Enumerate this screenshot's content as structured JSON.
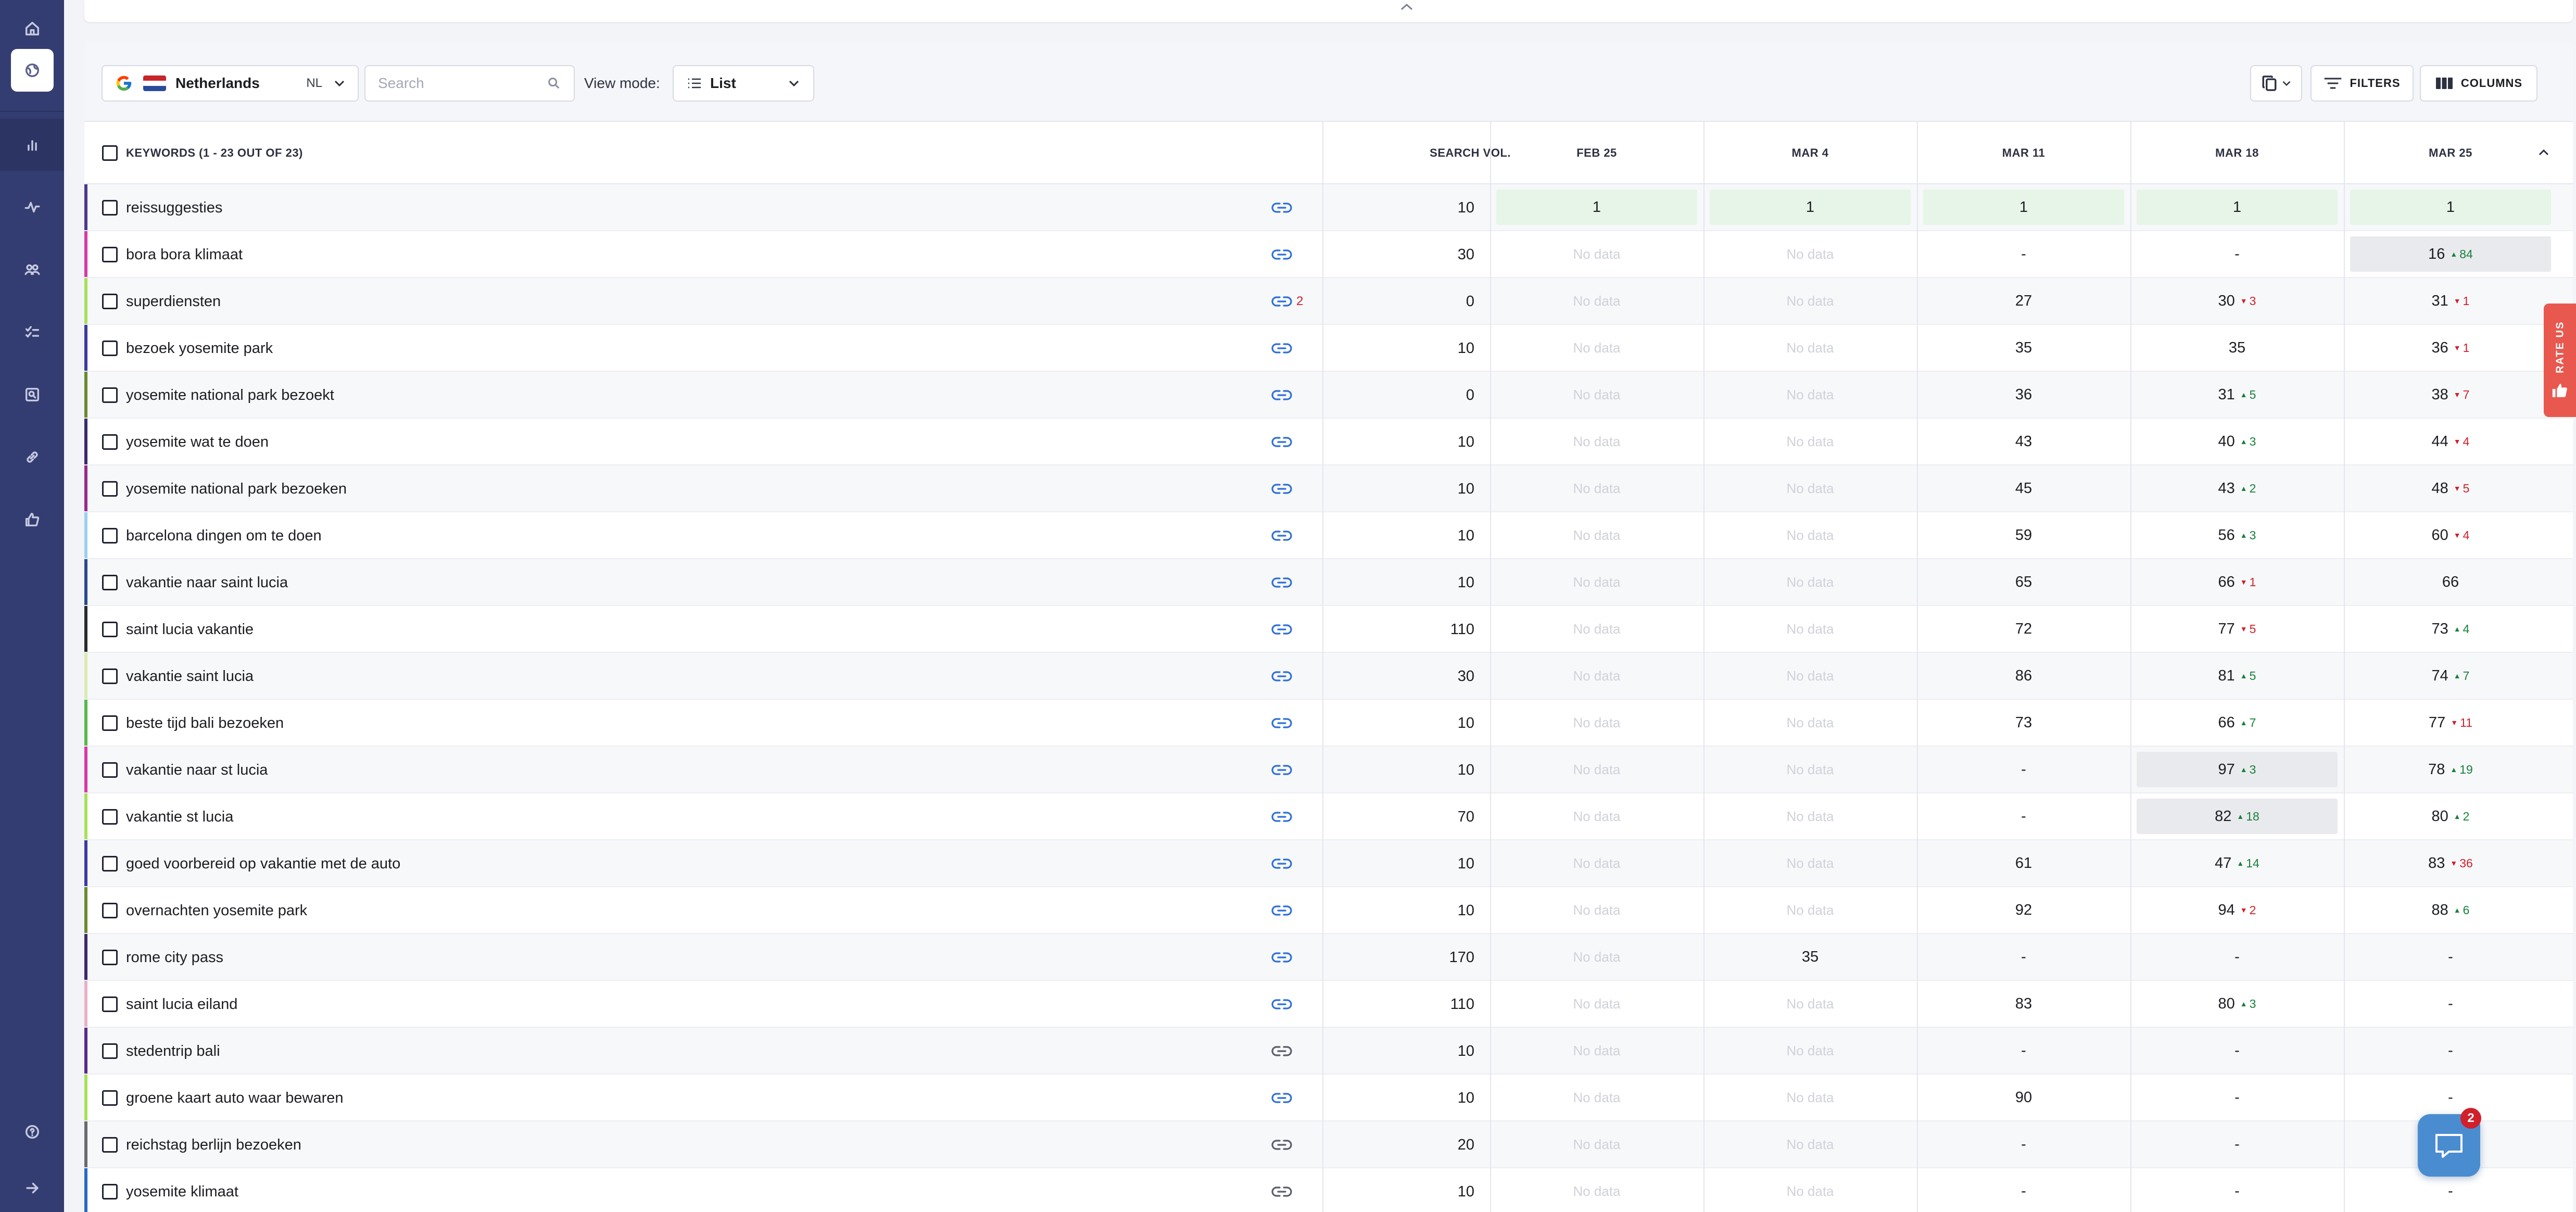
{
  "sidebar": {
    "icons": [
      "home-icon",
      "globe-icon",
      "bar-chart-icon",
      "activity-icon",
      "users-icon",
      "checklist-icon",
      "search-document-icon",
      "link-icon",
      "thumbs-up-icon",
      "help-icon",
      "expand-arrow-icon"
    ]
  },
  "toolbar": {
    "region_name": "Netherlands",
    "region_code": "NL",
    "search_placeholder": "Search",
    "view_mode_label": "View mode:",
    "view_mode_value": "List",
    "filters_label": "FILTERS",
    "columns_label": "COLUMNS"
  },
  "table": {
    "keywords_header": "KEYWORDS (1 - 23 OUT OF 23)",
    "search_vol_header": "SEARCH VOL.",
    "dates": [
      "FEB 25",
      "MAR 4",
      "MAR 11",
      "MAR 18",
      "MAR 25"
    ],
    "no_data_text": "No data",
    "rows": [
      {
        "keyword": "reissuggesties",
        "bar": "#4a3a8c",
        "link": "blue",
        "link_count": "",
        "vol": "10",
        "cells": [
          {
            "v": "1",
            "style": "green"
          },
          {
            "v": "1",
            "style": "green"
          },
          {
            "v": "1",
            "style": "green"
          },
          {
            "v": "1",
            "style": "green"
          },
          {
            "v": "1",
            "style": "green"
          }
        ]
      },
      {
        "keyword": "bora bora klimaat",
        "bar": "#d63aa4",
        "link": "blue",
        "link_count": "",
        "vol": "30",
        "cells": [
          {
            "v": "No data",
            "style": "nodata"
          },
          {
            "v": "No data",
            "style": "nodata"
          },
          {
            "v": "-"
          },
          {
            "v": "-"
          },
          {
            "v": "16",
            "style": "grey",
            "chg": "84",
            "dir": "up"
          }
        ]
      },
      {
        "keyword": "superdiensten",
        "bar": "#a8e05a",
        "link": "blue",
        "link_count": "2",
        "vol": "0",
        "cells": [
          {
            "v": "No data",
            "style": "nodata"
          },
          {
            "v": "No data",
            "style": "nodata"
          },
          {
            "v": "27"
          },
          {
            "v": "30",
            "chg": "3",
            "dir": "down"
          },
          {
            "v": "31",
            "chg": "1",
            "dir": "down"
          }
        ]
      },
      {
        "keyword": "bezoek yosemite park",
        "bar": "#3c3aa0",
        "link": "blue",
        "link_count": "",
        "vol": "10",
        "cells": [
          {
            "v": "No data",
            "style": "nodata"
          },
          {
            "v": "No data",
            "style": "nodata"
          },
          {
            "v": "35"
          },
          {
            "v": "35"
          },
          {
            "v": "36",
            "chg": "1",
            "dir": "down"
          }
        ]
      },
      {
        "keyword": "yosemite national park bezoekt",
        "bar": "#6a8a2e",
        "link": "blue",
        "link_count": "",
        "vol": "0",
        "cells": [
          {
            "v": "No data",
            "style": "nodata"
          },
          {
            "v": "No data",
            "style": "nodata"
          },
          {
            "v": "36"
          },
          {
            "v": "31",
            "chg": "5",
            "dir": "up"
          },
          {
            "v": "38",
            "chg": "7",
            "dir": "down"
          }
        ]
      },
      {
        "keyword": "yosemite wat te doen",
        "bar": "#3a2a6a",
        "link": "blue",
        "link_count": "",
        "vol": "10",
        "cells": [
          {
            "v": "No data",
            "style": "nodata"
          },
          {
            "v": "No data",
            "style": "nodata"
          },
          {
            "v": "43"
          },
          {
            "v": "40",
            "chg": "3",
            "dir": "up"
          },
          {
            "v": "44",
            "chg": "4",
            "dir": "down"
          }
        ]
      },
      {
        "keyword": "yosemite national park bezoeken",
        "bar": "#9a2a8a",
        "link": "blue",
        "link_count": "",
        "vol": "10",
        "cells": [
          {
            "v": "No data",
            "style": "nodata"
          },
          {
            "v": "No data",
            "style": "nodata"
          },
          {
            "v": "45"
          },
          {
            "v": "43",
            "chg": "2",
            "dir": "up"
          },
          {
            "v": "48",
            "chg": "5",
            "dir": "down"
          }
        ]
      },
      {
        "keyword": "barcelona dingen om te doen",
        "bar": "#9ad0f0",
        "link": "blue",
        "link_count": "",
        "vol": "10",
        "cells": [
          {
            "v": "No data",
            "style": "nodata"
          },
          {
            "v": "No data",
            "style": "nodata"
          },
          {
            "v": "59"
          },
          {
            "v": "56",
            "chg": "3",
            "dir": "up"
          },
          {
            "v": "60",
            "chg": "4",
            "dir": "down"
          }
        ]
      },
      {
        "keyword": "vakantie naar saint lucia",
        "bar": "#2a4a8c",
        "link": "blue",
        "link_count": "",
        "vol": "10",
        "cells": [
          {
            "v": "No data",
            "style": "nodata"
          },
          {
            "v": "No data",
            "style": "nodata"
          },
          {
            "v": "65"
          },
          {
            "v": "66",
            "chg": "1",
            "dir": "down"
          },
          {
            "v": "66"
          }
        ]
      },
      {
        "keyword": "saint lucia vakantie",
        "bar": "#2a2a2a",
        "link": "blue",
        "link_count": "",
        "vol": "110",
        "cells": [
          {
            "v": "No data",
            "style": "nodata"
          },
          {
            "v": "No data",
            "style": "nodata"
          },
          {
            "v": "72"
          },
          {
            "v": "77",
            "chg": "5",
            "dir": "down"
          },
          {
            "v": "73",
            "chg": "4",
            "dir": "up"
          }
        ]
      },
      {
        "keyword": "vakantie saint lucia",
        "bar": "#d8ecb0",
        "link": "blue",
        "link_count": "",
        "vol": "30",
        "cells": [
          {
            "v": "No data",
            "style": "nodata"
          },
          {
            "v": "No data",
            "style": "nodata"
          },
          {
            "v": "86"
          },
          {
            "v": "81",
            "chg": "5",
            "dir": "up"
          },
          {
            "v": "74",
            "chg": "7",
            "dir": "up"
          }
        ]
      },
      {
        "keyword": "beste tijd bali bezoeken",
        "bar": "#58b84a",
        "link": "blue",
        "link_count": "",
        "vol": "10",
        "cells": [
          {
            "v": "No data",
            "style": "nodata"
          },
          {
            "v": "No data",
            "style": "nodata"
          },
          {
            "v": "73"
          },
          {
            "v": "66",
            "chg": "7",
            "dir": "up"
          },
          {
            "v": "77",
            "chg": "11",
            "dir": "down"
          }
        ]
      },
      {
        "keyword": "vakantie naar st lucia",
        "bar": "#d63aa4",
        "link": "blue",
        "link_count": "",
        "vol": "10",
        "cells": [
          {
            "v": "No data",
            "style": "nodata"
          },
          {
            "v": "No data",
            "style": "nodata"
          },
          {
            "v": "-"
          },
          {
            "v": "97",
            "style": "grey",
            "chg": "3",
            "dir": "up"
          },
          {
            "v": "78",
            "chg": "19",
            "dir": "up"
          }
        ]
      },
      {
        "keyword": "vakantie st lucia",
        "bar": "#a8e05a",
        "link": "blue",
        "link_count": "",
        "vol": "70",
        "cells": [
          {
            "v": "No data",
            "style": "nodata"
          },
          {
            "v": "No data",
            "style": "nodata"
          },
          {
            "v": "-"
          },
          {
            "v": "82",
            "style": "grey",
            "chg": "18",
            "dir": "up"
          },
          {
            "v": "80",
            "chg": "2",
            "dir": "up"
          }
        ]
      },
      {
        "keyword": "goed voorbereid op vakantie met de auto",
        "bar": "#3c3aa0",
        "link": "blue",
        "link_count": "",
        "vol": "10",
        "cells": [
          {
            "v": "No data",
            "style": "nodata"
          },
          {
            "v": "No data",
            "style": "nodata"
          },
          {
            "v": "61"
          },
          {
            "v": "47",
            "chg": "14",
            "dir": "up"
          },
          {
            "v": "83",
            "chg": "36",
            "dir": "down"
          }
        ]
      },
      {
        "keyword": "overnachten yosemite park",
        "bar": "#6a8a2e",
        "link": "blue",
        "link_count": "",
        "vol": "10",
        "cells": [
          {
            "v": "No data",
            "style": "nodata"
          },
          {
            "v": "No data",
            "style": "nodata"
          },
          {
            "v": "92"
          },
          {
            "v": "94",
            "chg": "2",
            "dir": "down"
          },
          {
            "v": "88",
            "chg": "6",
            "dir": "up"
          }
        ]
      },
      {
        "keyword": "rome city pass",
        "bar": "#3a2a6a",
        "link": "blue",
        "link_count": "",
        "vol": "170",
        "cells": [
          {
            "v": "No data",
            "style": "nodata"
          },
          {
            "v": "35"
          },
          {
            "v": "-"
          },
          {
            "v": "-"
          },
          {
            "v": "-"
          }
        ]
      },
      {
        "keyword": "saint lucia eiland",
        "bar": "#e8b0c8",
        "link": "blue",
        "link_count": "",
        "vol": "110",
        "cells": [
          {
            "v": "No data",
            "style": "nodata"
          },
          {
            "v": "No data",
            "style": "nodata"
          },
          {
            "v": "83"
          },
          {
            "v": "80",
            "chg": "3",
            "dir": "up"
          },
          {
            "v": "-"
          }
        ]
      },
      {
        "keyword": "stedentrip bali",
        "bar": "#5a2a8a",
        "link": "grey",
        "link_count": "",
        "vol": "10",
        "cells": [
          {
            "v": "No data",
            "style": "nodata"
          },
          {
            "v": "No data",
            "style": "nodata"
          },
          {
            "v": "-"
          },
          {
            "v": "-"
          },
          {
            "v": "-"
          }
        ]
      },
      {
        "keyword": "groene kaart auto waar bewaren",
        "bar": "#a8e05a",
        "link": "blue",
        "link_count": "",
        "vol": "10",
        "cells": [
          {
            "v": "No data",
            "style": "nodata"
          },
          {
            "v": "No data",
            "style": "nodata"
          },
          {
            "v": "90"
          },
          {
            "v": "-"
          },
          {
            "v": "-"
          }
        ]
      },
      {
        "keyword": "reichstag berlijn bezoeken",
        "bar": "#6a6a70",
        "link": "grey",
        "link_count": "",
        "vol": "20",
        "cells": [
          {
            "v": "No data",
            "style": "nodata"
          },
          {
            "v": "No data",
            "style": "nodata"
          },
          {
            "v": "-"
          },
          {
            "v": "-"
          },
          {
            "v": "-"
          }
        ]
      },
      {
        "keyword": "yosemite klimaat",
        "bar": "#2a6ac0",
        "link": "grey",
        "link_count": "",
        "vol": "10",
        "cells": [
          {
            "v": "No data",
            "style": "nodata"
          },
          {
            "v": "No data",
            "style": "nodata"
          },
          {
            "v": "-"
          },
          {
            "v": "-"
          },
          {
            "v": "-"
          }
        ]
      }
    ]
  },
  "rate_us": {
    "label": "RATE US"
  },
  "chat": {
    "badge_count": "2"
  },
  "colors": {
    "sidebar": "#343d71",
    "link_blue": "#2f6fd6",
    "link_grey": "#5a5d6a",
    "up": "#17803a",
    "down": "#d0202b",
    "green_cell": "#e6f5e7",
    "rate_us": "#e8584f",
    "chat": "#4a8cd0"
  }
}
